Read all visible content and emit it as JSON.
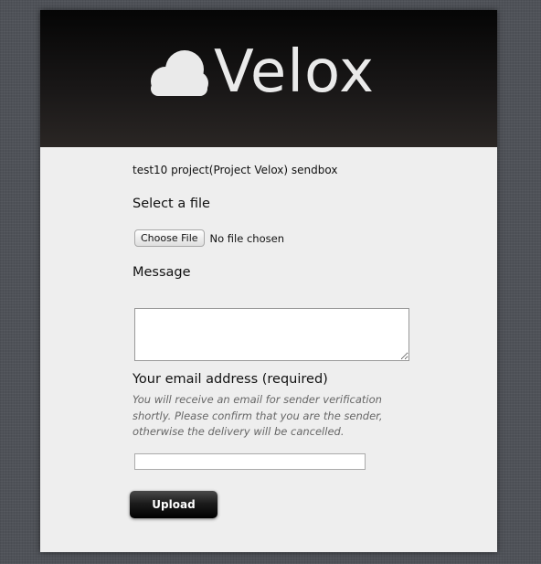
{
  "header": {
    "logo_icon": "cloud-icon",
    "logo_text": "Velox"
  },
  "form": {
    "project_line": "test10 project(Project Velox) sendbox",
    "file_label": "Select a file",
    "file_button_label": "Choose File",
    "file_status": "No file chosen",
    "message_label": "Message",
    "message_value": "",
    "email_label": "Your email address (required)",
    "email_hint": "You will receive an email for sender verification shortly. Please confirm that you are the sender, otherwise the delivery will be cancelled.",
    "email_value": "",
    "upload_label": "Upload"
  },
  "colors": {
    "page_background": "#4f5258",
    "card_background": "#eeeeee",
    "header_background": "#0e0d0d",
    "logo_color": "#eaeaea",
    "hint_color": "#666666",
    "upload_button": "#111111"
  }
}
